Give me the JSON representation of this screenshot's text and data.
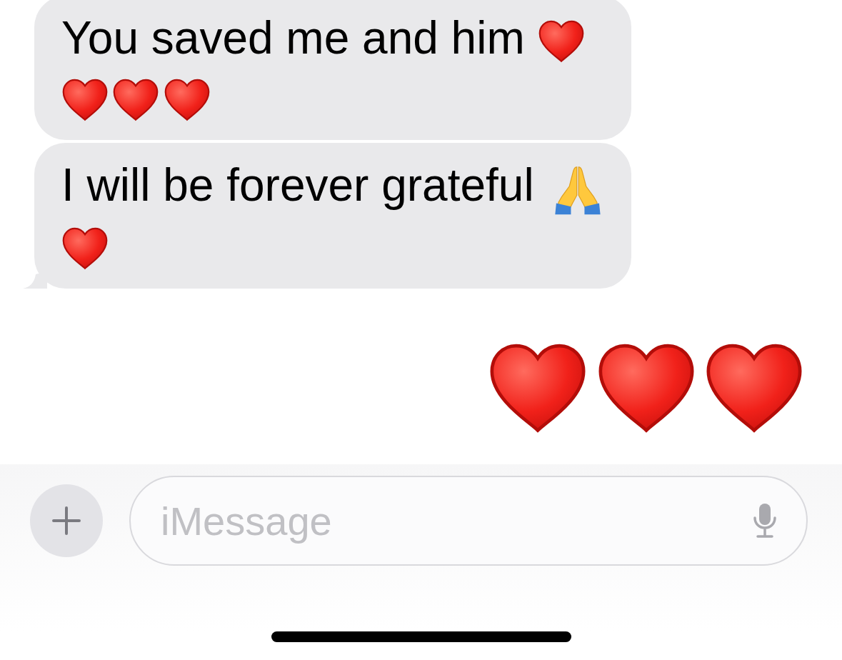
{
  "messages": [
    {
      "kind": "incoming",
      "text": "You saved me and him",
      "emojis": [
        {
          "kind": "heart"
        },
        {
          "kind": "heart"
        },
        {
          "kind": "heart"
        },
        {
          "kind": "heart"
        }
      ],
      "tail": false
    },
    {
      "kind": "incoming",
      "text": "I will be forever grateful",
      "emojis": [
        {
          "kind": "praying-hands"
        },
        {
          "kind": "heart"
        }
      ],
      "tail": true
    },
    {
      "kind": "outgoing",
      "emojis": [
        {
          "kind": "heart"
        },
        {
          "kind": "heart"
        },
        {
          "kind": "heart"
        }
      ],
      "tail": false
    }
  ],
  "composer": {
    "placeholder": "iMessage"
  }
}
